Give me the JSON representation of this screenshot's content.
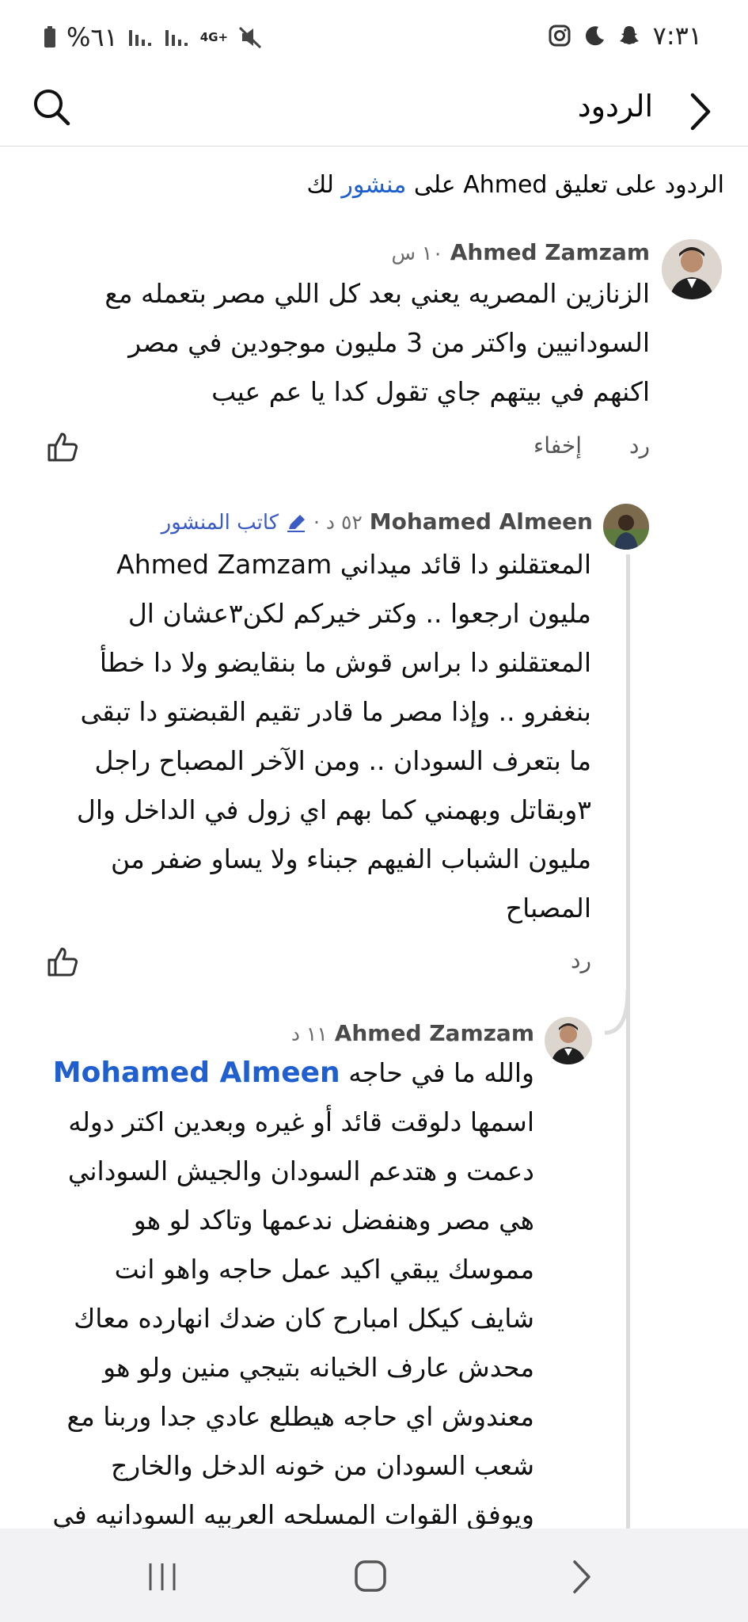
{
  "status_bar": {
    "time": "٧:٣١",
    "battery": "%٦١",
    "network": "4G+",
    "icons": [
      "instagram-icon",
      "moon-icon",
      "snapchat-icon",
      "signal-icon",
      "mute-icon",
      "battery-icon"
    ]
  },
  "header": {
    "title": "الردود",
    "back_icon": "chevron-right-icon",
    "search_icon": "search-icon"
  },
  "context": {
    "prefix": "الردود على تعليق Ahmed على",
    "link": "منشور",
    "suffix": "لك"
  },
  "comments": [
    {
      "author": "Ahmed Zamzam",
      "meta": "١٠ س",
      "lines": [
        "الزنازين المصريه يعني بعد كل اللي مصر بتعمله مع",
        "السودانيين واكتر من 3 مليون موجودين في مصر",
        "اكنهم في بيتهم جاي تقول كدا يا عم عيب"
      ],
      "reply_label": "رد",
      "hide_label": "إخفاء"
    },
    {
      "author": "Mohamed Almeen",
      "meta": "٥٢ د ·",
      "badge": "كاتب المنشور",
      "lines": [
        "المعتقلنو دا قائد ميداني Ahmed Zamzam",
        " مليون ارجعوا .. وكتر خيركم لكن٣عشان ال",
        "المعتقلنو دا براس قوش ما بنقايضو ولا دا خطأ",
        "بنغفرو .. وإذا مصر ما قادر تقيم القبضتو دا تبقى",
        "ما بتعرف السودان .. ومن الآخر المصباح راجل",
        "٣وبقاتل وبهمني كما بهم اي زول في الداخل وال",
        "مليون الشباب الفيهم جبناء ولا يساو ضفر من",
        "المصباح"
      ],
      "reply_label": "رد"
    },
    {
      "author": "Ahmed Zamzam",
      "meta": "١١ د",
      "mention": "Mohamed Almeen",
      "first_line_text": "والله ما في حاجه",
      "lines": [
        "اسمها دلوقت قائد أو غيره وبعدين اكتر دوله",
        "دعمت و هتدعم السودان والجيش السوداني",
        "هي مصر وهنفضل ندعمها وتاكد لو هو",
        "مموسك يبقي اكيد عمل حاجه واهو انت",
        "شايف كيكل امبارح كان ضدك انهارده معاك",
        "محدش عارف الخيانه بتيجي منين ولو هو",
        "معندوش اي حاجه هيطلع عادي جدا وربنا مع",
        "شعب السودان من خونه الدخل والخارج",
        "ويوفق القوات المسلحه العربيه السودانيه في"
      ]
    }
  ],
  "nav": {
    "recent_icon": "recent-apps-icon",
    "home_icon": "home-icon",
    "back_icon": "back-icon"
  }
}
